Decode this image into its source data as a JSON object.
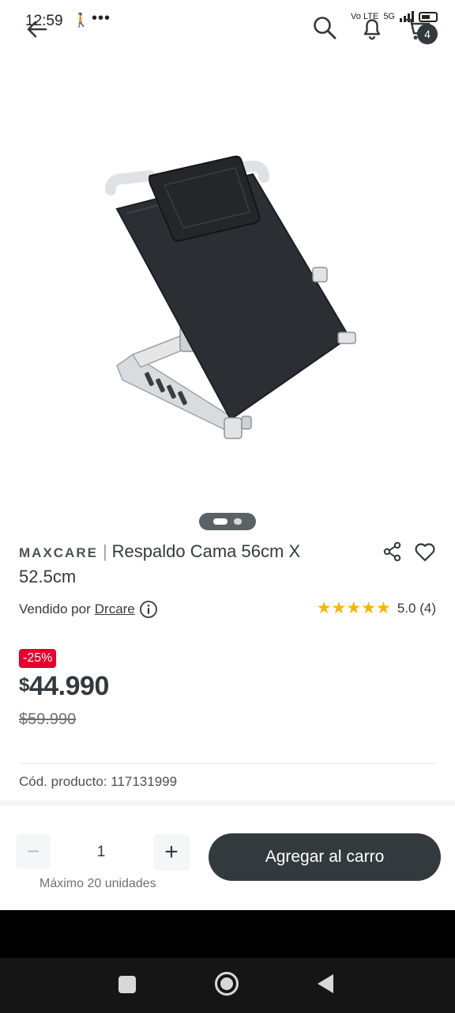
{
  "status_bar": {
    "time": "12:59",
    "walk_glyph": "🚶",
    "more_glyph": "•••",
    "volte_label": "Vo LTE",
    "network": "5G",
    "cart_count": "4"
  },
  "header": {
    "back_icon": "arrow-left-icon",
    "search_icon": "search-icon",
    "notifications_icon": "bell-icon",
    "cart_icon": "cart-icon"
  },
  "carousel": {
    "image_count": 2,
    "active_index": 0
  },
  "product": {
    "brand": "MAXCARE",
    "separator": "|",
    "name": "Respaldo Cama 56cm X 52.5cm",
    "sold_by_prefix": "Vendido por",
    "seller": "Drcare",
    "rating": 5.0,
    "rating_label": "5.0 (4)",
    "stars": "★★★★★",
    "discount": "-25%",
    "price_currency": "$",
    "price": "44.990",
    "old_price": "$59.990",
    "code_label": "Cód. producto: 117131999"
  },
  "purchase": {
    "minus": "−",
    "quantity": "1",
    "plus": "+",
    "max_units": "Máximo 20 unidades",
    "add_to_cart": "Agregar al carro"
  },
  "colors": {
    "primary": "#333a3d",
    "discount": "#e4002b",
    "star": "#f7b500"
  }
}
